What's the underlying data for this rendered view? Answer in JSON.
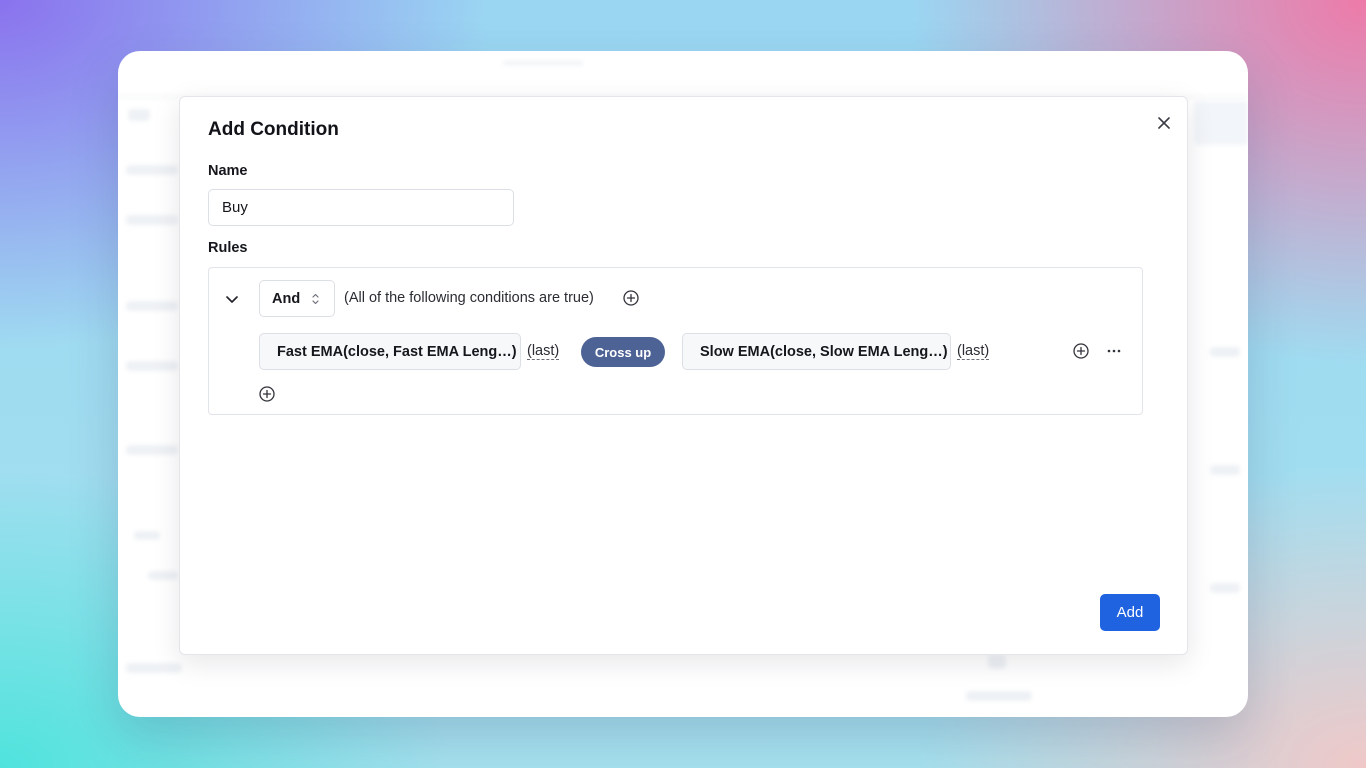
{
  "modal": {
    "title": "Add Condition",
    "name_label": "Name",
    "name_value": "Buy",
    "rules_label": "Rules",
    "add_label": "Add"
  },
  "rules": {
    "logic_selected": "And",
    "logic_description": "(All of the following conditions are true)",
    "condition": {
      "left_operand": "Fast EMA(close, Fast EMA Leng…)",
      "left_qualifier": "(last)",
      "operator": "Cross up",
      "right_operand": "Slow EMA(close, Slow EMA Leng…)",
      "right_qualifier": "(last)"
    }
  },
  "icons": {
    "close": "close-icon",
    "collapse": "chevron-down-icon",
    "select": "updown-icon",
    "add_rule": "plus-circle-icon",
    "more": "more-horizontal-icon"
  },
  "colors": {
    "primary": "#1f63e0",
    "operator_pill": "#4d6396"
  }
}
